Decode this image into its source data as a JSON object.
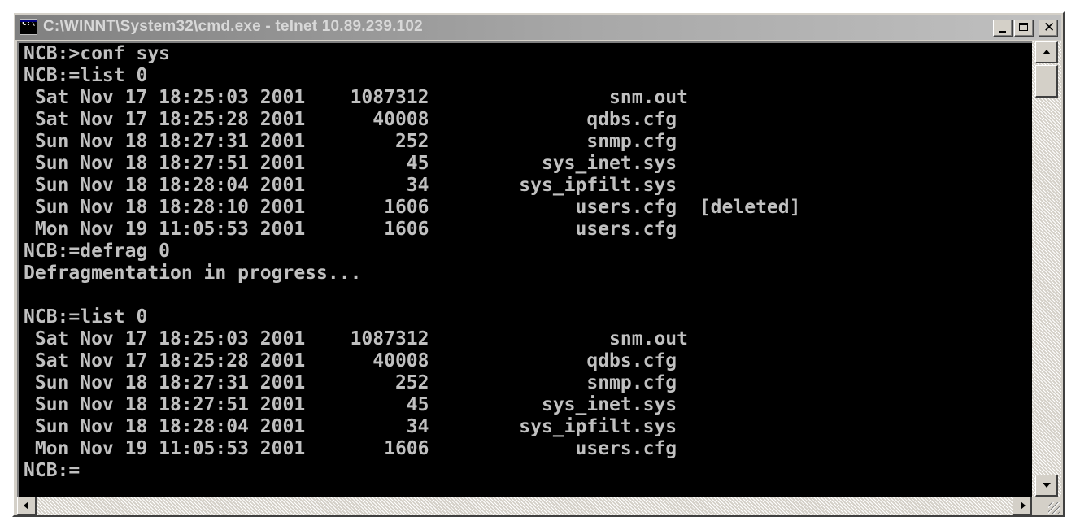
{
  "window": {
    "title": "C:\\WINNT\\System32\\cmd.exe - telnet 10.89.239.102",
    "icon_text": "C:\\"
  },
  "controls": {
    "minimize_icon": "minimize-icon",
    "maximize_icon": "maximize-icon",
    "close_glyph": "✕"
  },
  "console": {
    "lines": [
      "NCB:>conf sys",
      "NCB:=list 0",
      " Sat Nov 17 18:25:03 2001    1087312                snm.out",
      " Sat Nov 17 18:25:28 2001      40008              qdbs.cfg",
      " Sun Nov 18 18:27:31 2001        252              snmp.cfg",
      " Sun Nov 18 18:27:51 2001         45          sys_inet.sys",
      " Sun Nov 18 18:28:04 2001         34        sys_ipfilt.sys",
      " Sun Nov 18 18:28:10 2001       1606             users.cfg  [deleted]",
      " Mon Nov 19 11:05:53 2001       1606             users.cfg",
      "NCB:=defrag 0",
      "Defragmentation in progress...",
      "",
      "NCB:=list 0",
      " Sat Nov 17 18:25:03 2001    1087312                snm.out",
      " Sat Nov 17 18:25:28 2001      40008              qdbs.cfg",
      " Sun Nov 18 18:27:31 2001        252              snmp.cfg",
      " Sun Nov 18 18:27:51 2001         45          sys_inet.sys",
      " Sun Nov 18 18:28:04 2001         34        sys_ipfilt.sys",
      " Mon Nov 19 11:05:53 2001       1606             users.cfg",
      "NCB:="
    ]
  },
  "colors": {
    "console_bg": "#000000",
    "console_fg": "#c0c0c0",
    "titlebar_inactive": "#808080",
    "chrome": "#d4d0c8"
  }
}
